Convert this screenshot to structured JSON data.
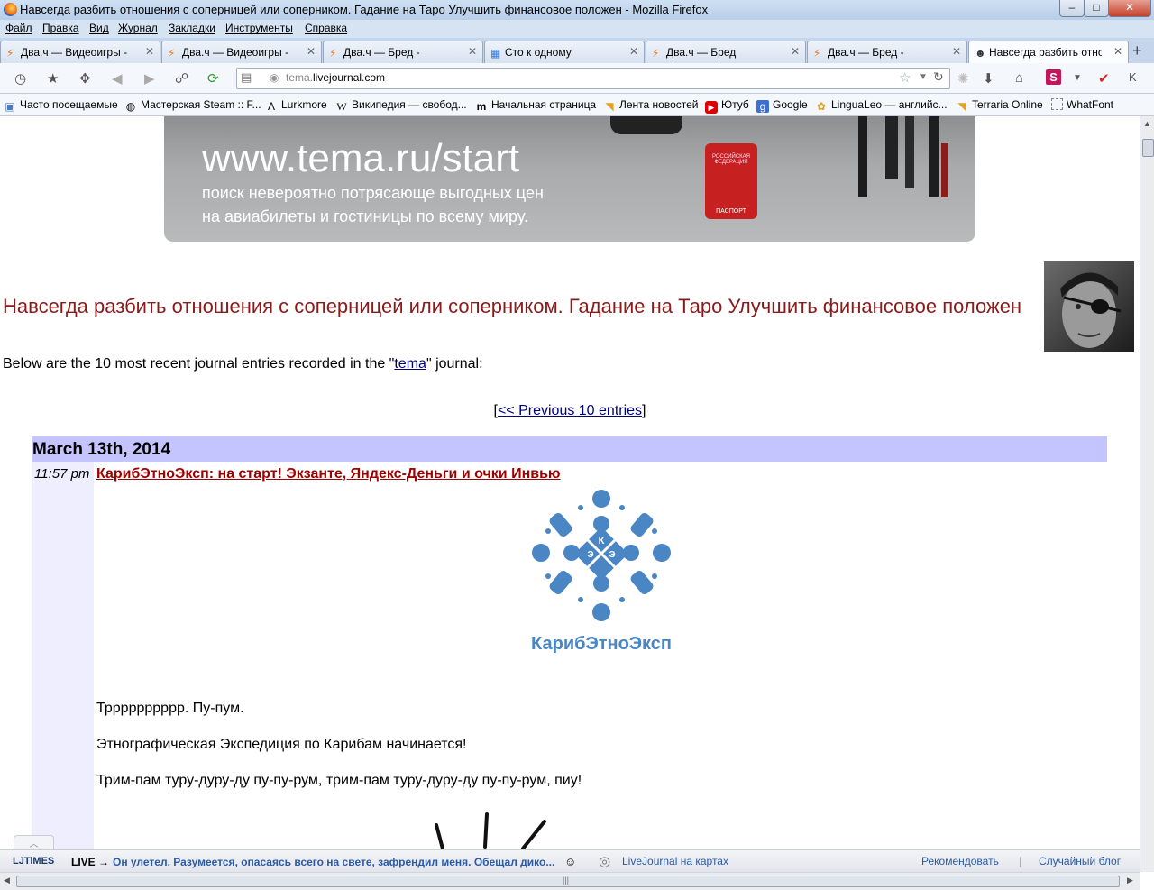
{
  "window": {
    "title": "Навсегда разбить отношения с соперницей или соперником. Гадание на Таро Улучшить финансовое положен - Mozilla Firefox",
    "minimize": "–",
    "maximize": "□",
    "close": "✕"
  },
  "menu": [
    "Файл",
    "Правка",
    "Вид",
    "Журнал",
    "Закладки",
    "Инструменты",
    "Справка"
  ],
  "tabs": [
    {
      "label": "Два.ч — Видеоигры -",
      "active": false
    },
    {
      "label": "Два.ч — Видеоигры -",
      "active": false
    },
    {
      "label": "Два.ч — Бред -",
      "active": false
    },
    {
      "label": "Сто к одному",
      "active": false
    },
    {
      "label": "Два.ч — Бред",
      "active": false
    },
    {
      "label": "Два.ч — Бред -",
      "active": false
    },
    {
      "label": "Навсегда разбить отно...",
      "active": true
    }
  ],
  "new_tab": "+",
  "urlbar": {
    "host_prefix": "tema.",
    "host_main": "livejournal.com"
  },
  "bookmarks": [
    "Часто посещаемые",
    "Мастерская Steam :: F...",
    "Lurkmore",
    "Википедия — свобод...",
    "Начальная страница",
    "Лента новостей",
    "Ютуб",
    "Google",
    "LinguaLeo — английс...",
    "Terraria Online",
    "WhatFont"
  ],
  "banner": {
    "line1": "www.tema.ru/start",
    "line2": "поиск невероятно потрясающе выгодных цен",
    "line3": "на авиабилеты и гостиницы по всему миру.",
    "case_top": "РОССИЙСКАЯ ФЕДЕРАЦИЯ",
    "case_label": "ПАСПОРТ"
  },
  "journal": {
    "title": "Навсегда разбить отношения с соперницей или соперником. Гадание на Таро Улучшить финансовое положен",
    "intro_before": "Below are the 10 most recent journal entries recorded in the \"",
    "intro_link": "tema",
    "intro_after": "\" journal:",
    "prev_open": "[",
    "prev_link": "<< Previous 10 entries",
    "prev_close": "]"
  },
  "entry": {
    "date": "March 13th, 2014",
    "time": "11:57 pm",
    "title": "КарибЭтноЭксп: на старт! Экзанте, Яндекс-Деньги и очки Инвью",
    "logo_text": "КарибЭтноЭксп",
    "logo_letters": [
      "К",
      "Э",
      "Э"
    ],
    "paragraphs": [
      "Трррррррррр. Пу-пум.",
      "Этнографическая Экспедиция по Карибам начинается!",
      "Трим-пам туру-дуру-ду пу-пу-рум, трим-пам туру-дуру-ду пу-пу-рум, пиу!"
    ]
  },
  "ljtimes": {
    "logo": "LJTiMES",
    "live": "LIVE →",
    "news": "Он улетел. Разумеется, опасаясь всего на свете, зафрендил меня. Обещал дико...",
    "maps": "LiveJournal на картах",
    "recommend": "Рекомендовать",
    "random": "Случайный блог"
  },
  "colors": {
    "title_red": "#8b1a1a",
    "date_band": "#c4c4ff",
    "left_column": "#eeeeff",
    "link_blue": "#00007f",
    "entry_title": "#a00000",
    "logo_blue": "#4a86c4"
  }
}
